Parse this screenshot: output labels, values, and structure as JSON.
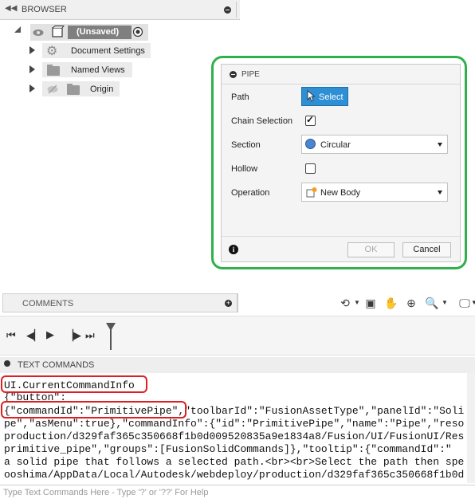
{
  "browser": {
    "title": "BROWSER",
    "root_label": "(Unsaved)",
    "items": [
      {
        "label": "Document Settings",
        "icon": "gear-icon"
      },
      {
        "label": "Named Views",
        "icon": "folder-icon"
      },
      {
        "label": "Origin",
        "icon": "folder-icon"
      }
    ]
  },
  "pipe_dialog": {
    "title": "PIPE",
    "path_label": "Path",
    "select_label": "Select",
    "chain_selection_label": "Chain Selection",
    "chain_selection_checked": true,
    "section_label": "Section",
    "section_value": "Circular",
    "hollow_label": "Hollow",
    "hollow_checked": false,
    "operation_label": "Operation",
    "operation_value": "New Body",
    "ok_label": "OK",
    "cancel_label": "Cancel"
  },
  "comments": {
    "title": "COMMENTS"
  },
  "text_commands": {
    "title": "TEXT COMMANDS",
    "lines": [
      "UI.CurrentCommandInfo",
      "{\"button\":",
      "{\"commandId\":\"PrimitivePipe\",\"toolbarId\":\"FusionAssetType\",\"panelId\":\"Soli",
      "pe\",\"asMenu\":true},\"commandInfo\":{\"id\":\"PrimitivePipe\",\"name\":\"Pipe\",\"reso",
      "production/d329faf365c350668f1b0d009520835a9e1834a8/Fusion/UI/FusionUI/Res",
      "primitive_pipe\",\"groups\":[FusionSolidCommands]},\"tooltip\":{\"commandId\":\"",
      "a solid pipe that follows a selected path.<br><br>Select the path then spe",
      "ooshima/AppData/Local/Autodesk/webdeploy/production/d329faf365c350668f1b0d"
    ],
    "input_placeholder": "Type Text Commands Here - Type '?' or '??' For Help"
  },
  "colors": {
    "accent": "#2e8fd4",
    "highlight_green": "#2fb04a",
    "highlight_red": "#e02020"
  }
}
